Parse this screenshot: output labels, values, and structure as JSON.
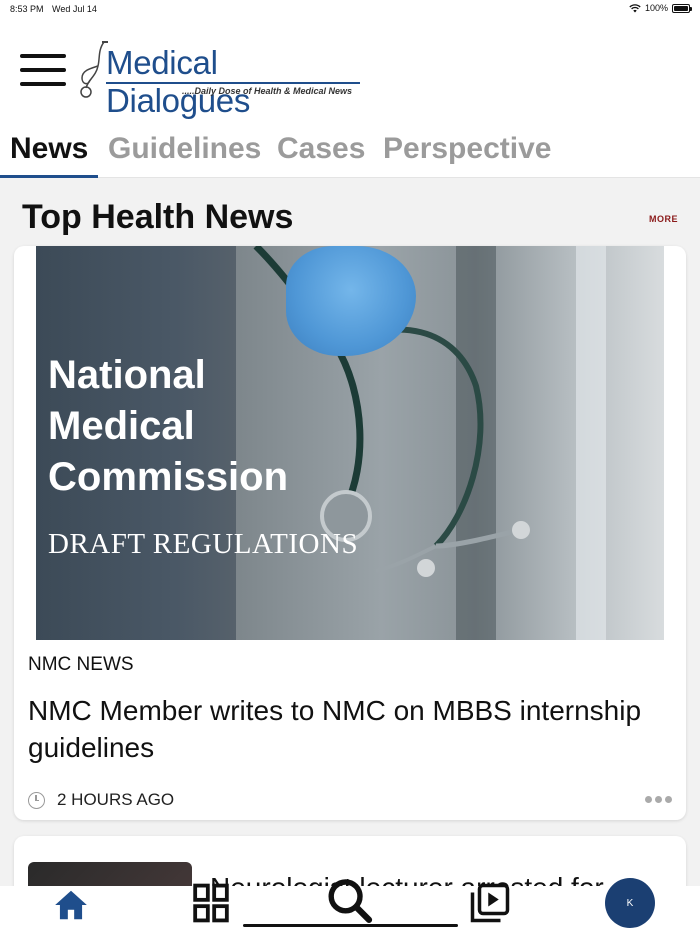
{
  "status_bar": {
    "time": "8:53 PM",
    "date": "Wed Jul 14",
    "battery": "100%"
  },
  "header": {
    "logo_title": "Medical Dialogues",
    "logo_tagline": ".....Daily Dose of Health & Medical News"
  },
  "tabs": [
    {
      "label": "News",
      "active": true
    },
    {
      "label": "Guidelines",
      "active": false
    },
    {
      "label": "Cases",
      "active": false
    },
    {
      "label": "Perspective",
      "active": false
    }
  ],
  "section": {
    "title": "Top Health News",
    "more_label": "MORE"
  },
  "featured": {
    "image_text_lines": [
      "National",
      "Medical",
      "Commission"
    ],
    "image_subtext": "DRAFT REGULATIONS",
    "category": "NMC NEWS",
    "headline": "NMC Member writes to NMC on MBBS internship guidelines",
    "time_ago": "2 HOURS AGO"
  },
  "second_item": {
    "title_partial": "Neurologist lecturer arrested for"
  },
  "bottom_nav": {
    "items": [
      "home-icon",
      "grid-icon",
      "search-icon",
      "video-library-icon"
    ],
    "avatar_initial": "K"
  },
  "colors": {
    "brand": "#1f4e8c",
    "more_link": "#8b1a1a",
    "avatar": "#1b3f72"
  }
}
